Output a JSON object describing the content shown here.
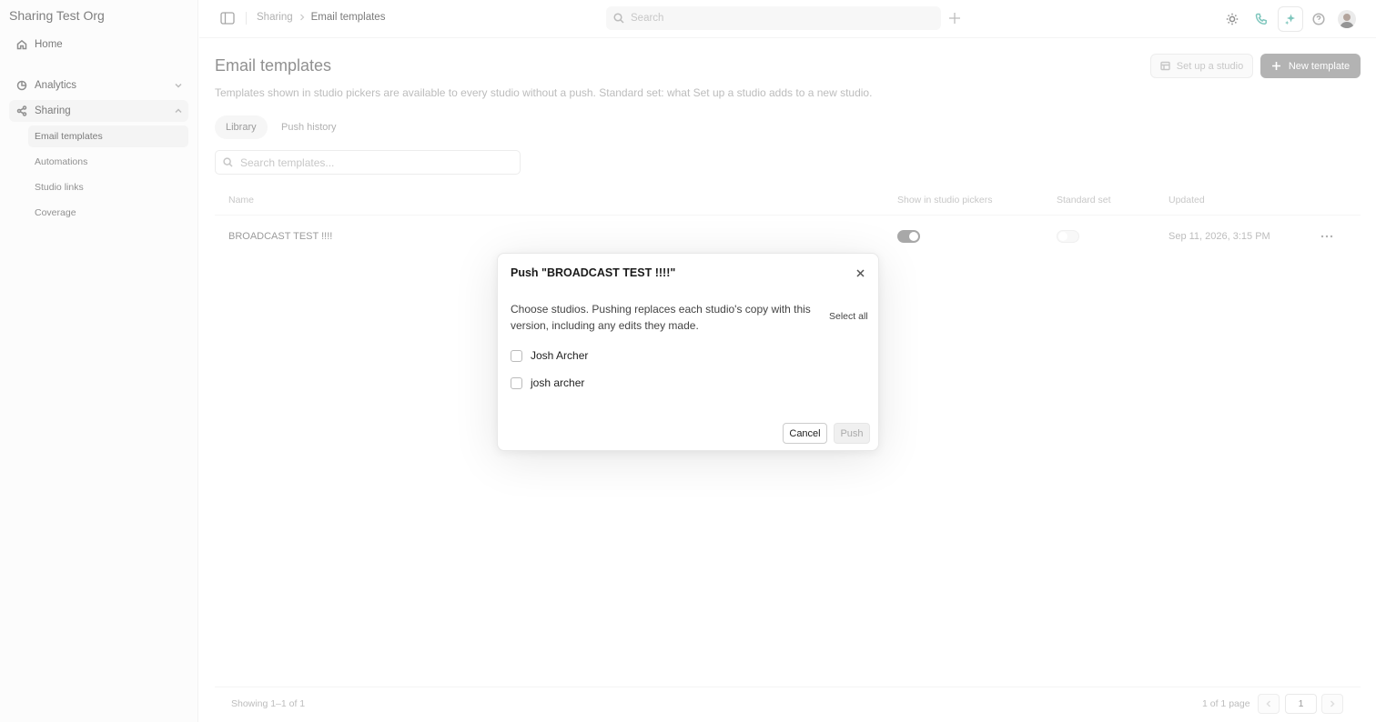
{
  "org_name": "Sharing Test Org",
  "sidebar": {
    "home": "Home",
    "analytics": "Analytics",
    "sharing": "Sharing",
    "sub_items": [
      "Email templates",
      "Automations",
      "Studio links",
      "Coverage"
    ]
  },
  "topbar": {
    "breadcrumb": [
      "Sharing",
      "Email templates"
    ],
    "search_placeholder": "Search"
  },
  "page": {
    "title": "Email templates",
    "description": "Templates shown in studio pickers are available to every studio without a push. Standard set: what Set up a studio adds to a new studio.",
    "setup_label": "Set up a studio",
    "new_label": "New template",
    "tabs": [
      "Library",
      "Push history"
    ],
    "active_tab": "Library",
    "search_placeholder": "Search templates..."
  },
  "table": {
    "columns": [
      "Name",
      "Show in studio pickers",
      "Standard set",
      "Updated"
    ],
    "rows": [
      {
        "name": "BROADCAST TEST !!!!",
        "show_in_pickers": true,
        "standard_set": false,
        "updated": "Sep 11, 2026, 3:15 PM"
      }
    ]
  },
  "footer": {
    "showing": "Showing 1–1 of 1",
    "pages": "1 of 1 page",
    "current_page": "1"
  },
  "modal": {
    "title": "Push \"BROADCAST TEST !!!!\"",
    "description": "Choose studios. Pushing replaces each studio's copy with this version, including any edits they made.",
    "select_all": "Select all",
    "studios": [
      "Josh Archer",
      "josh archer"
    ],
    "cancel": "Cancel",
    "push": "Push"
  },
  "colors": {
    "accent_ai": "#3aa89a",
    "phone": "#3aa89a",
    "primary_button": "#8a8a8a"
  }
}
